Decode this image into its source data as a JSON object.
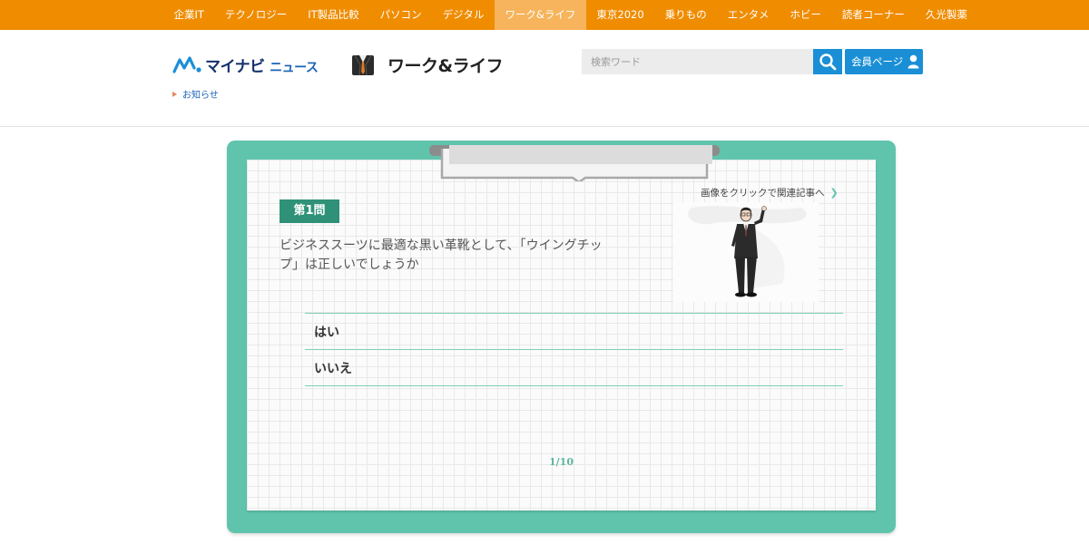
{
  "nav": {
    "items": [
      "企業IT",
      "テクノロジー",
      "IT製品比較",
      "パソコン",
      "デジタル",
      "ワーク&ライフ",
      "東京2020",
      "乗りもの",
      "エンタメ",
      "ホビー",
      "読者コーナー",
      "久光製薬"
    ],
    "active_index": 5
  },
  "header": {
    "logo_main": "マイナビ",
    "logo_sub": "ニュース",
    "section_title": "ワーク&ライフ",
    "search_placeholder": "検索ワード",
    "member_label": "会員ページ",
    "news_link": "お知らせ"
  },
  "quiz": {
    "badge": "第1問",
    "question": "ビジネススーツに最適な黒い革靴として、「ウイングチップ」は正しいでしょうか",
    "related_link": "画像をクリックで関連記事へ",
    "answers": [
      "はい",
      "いいえ"
    ],
    "progress": "1/10"
  },
  "colors": {
    "nav_bg": "#f08c00",
    "nav_active": "#f7b45c",
    "accent_blue": "#1a8fd6",
    "board_green": "#60c4ad",
    "badge_green": "#2f9278"
  }
}
